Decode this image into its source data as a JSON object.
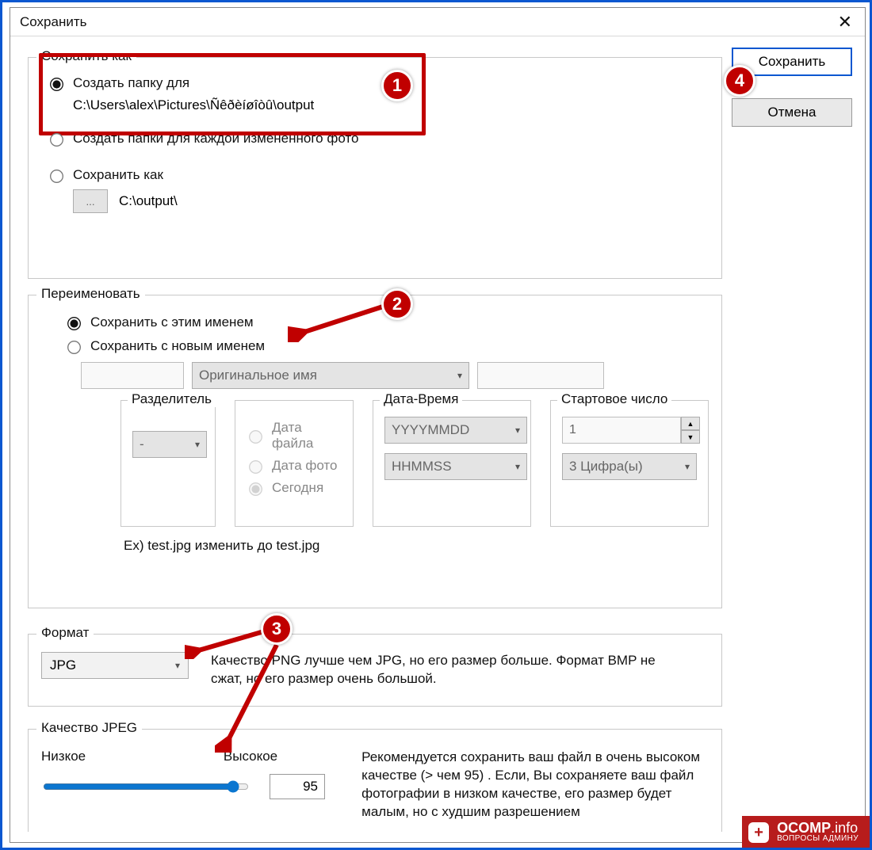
{
  "window": {
    "title": "Сохранить"
  },
  "buttons": {
    "save": "Сохранить",
    "cancel": "Отмена"
  },
  "saveAs": {
    "legend": "Сохранить как",
    "opt1": "Создать папку для",
    "opt1_path": "C:\\Users\\alex\\Pictures\\Ñêðèíøîòû\\output",
    "opt2": "Создать папки для каждой измененного фото",
    "opt3": "Сохранить как",
    "opt3_browse": "...",
    "opt3_path": "C:\\output\\"
  },
  "rename": {
    "legend": "Переименовать",
    "opt1": "Сохранить с этим именем",
    "opt2": "Сохранить с новым именем",
    "prefix": "",
    "name_mode": "Оригинальное имя",
    "suffix": "",
    "separator_legend": "Разделитель",
    "separator_value": "-",
    "date_opts_legend": " ",
    "date_file": "Дата файла",
    "date_photo": "Дата фото",
    "date_today": "Сегодня",
    "datetime_legend": "Дата-Время",
    "date_fmt": "YYYYMMDD",
    "time_fmt": "HHMMSS",
    "startnum_legend": "Стартовое число",
    "start_value": "1",
    "digits": "3 Цифра(ы)",
    "example": "Ex) test.jpg изменить до test.jpg"
  },
  "format": {
    "legend": "Формат",
    "value": "JPG",
    "note": "Качество PNG лучше чем JPG, но его размер  больше. Формат BMP не сжат, но его размер  очень большой."
  },
  "jpeg": {
    "legend": "Качество JPEG",
    "low": "Низкое",
    "high": "Высокое",
    "value": "95",
    "note": "Рекомендуется сохранить ваш файл в  очень высоком качестве (> чем 95) .\nЕсли, Вы сохраняете ваш файл фотографии в низком качестве, его размер будет малым, но с худшим  разрешением"
  },
  "badges": {
    "b1": "1",
    "b2": "2",
    "b3": "3",
    "b4": "4"
  },
  "watermark": {
    "brand": "OCOMP",
    "tld": ".info",
    "sub": "ВОПРОСЫ АДМИНУ"
  }
}
